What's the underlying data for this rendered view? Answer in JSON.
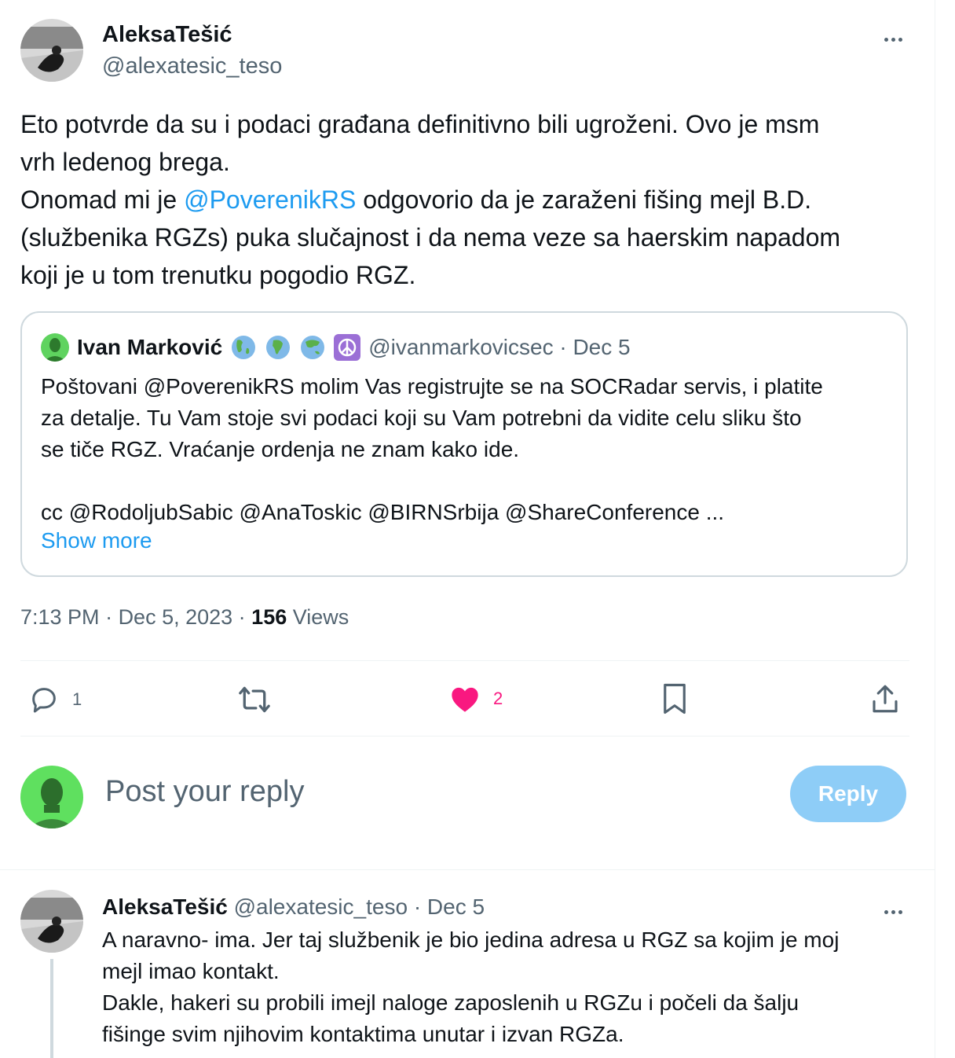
{
  "tweet": {
    "author_name": "AleksaTešić",
    "author_handle": "@alexatesic_teso",
    "text_lines": [
      {
        "pre": "Eto potvrde da su i podaci građana definitivno bili ugroženi. Ovo je msm",
        "mention": "",
        "post": ""
      },
      {
        "pre": "vrh ledenog brega.",
        "mention": "",
        "post": ""
      },
      {
        "pre": "Onomad mi je ",
        "mention": "@PoverenikRS",
        "post": " odgovorio da je zaraženi fišing mejl B.D."
      },
      {
        "pre": "(službenika RGZs) puka slučajnost i da nema veze sa haerskim napadom",
        "mention": "",
        "post": ""
      },
      {
        "pre": "koji je u tom trenutku pogodio RGZ.",
        "mention": "",
        "post": ""
      }
    ],
    "time": "7:13 PM",
    "date": "Dec 5, 2023",
    "views_count": "156",
    "views_label": "Views"
  },
  "quote": {
    "name": "Ivan Marković",
    "emojis": [
      "globe-americas-icon",
      "globe-africa-icon",
      "globe-asia-icon",
      "peace-icon"
    ],
    "meta": "@ivanmarkovicsec · Dec 5",
    "lines": [
      "Poštovani @PoverenikRS molim Vas registrujte se na SOCRadar servis, i platite",
      "za detalje. Tu Vam stoje svi podaci koji su Vam potrebni da vidite celu sliku što",
      "se tiče RGZ. Vraćanje ordenja ne znam kako ide.",
      "",
      "cc @RodoljubSabic @AnaToskic @BIRNSrbija @ShareConference ..."
    ],
    "show_more": "Show more"
  },
  "actions": {
    "reply_count": "1",
    "retweet_count": "",
    "like_count": "2",
    "like_color": "#f91880",
    "accent": "#1d9bf0"
  },
  "composer": {
    "placeholder": "Post your reply",
    "button": "Reply"
  },
  "reply": {
    "name": "AleksaTešić",
    "handle": "@alexatesic_teso",
    "meta": "· Dec 5",
    "lines": [
      "A naravno- ima. Jer taj službenik je bio jedina adresa u RGZ sa kojim je moj",
      "mejl imao kontakt.",
      "Dakle, hakeri su probili imejl naloge zaposlenih u RGZu i počeli da šalju",
      "fišinge svim njihovim kontaktima unutar i izvan RGZa."
    ]
  }
}
